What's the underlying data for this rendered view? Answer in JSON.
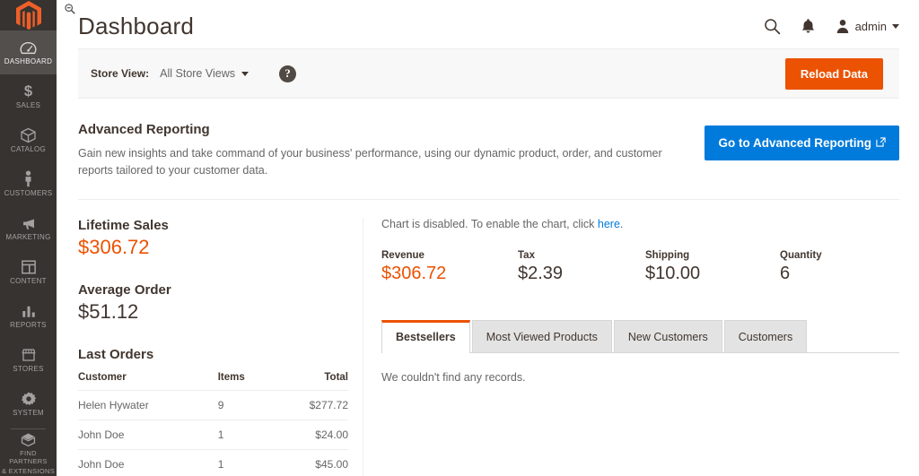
{
  "sidebar": {
    "logo": "magento-logo",
    "items": [
      {
        "label": "DASHBOARD",
        "icon": "gauge-icon",
        "active": true
      },
      {
        "label": "SALES",
        "icon": "dollar-icon",
        "active": false
      },
      {
        "label": "CATALOG",
        "icon": "box-icon",
        "active": false
      },
      {
        "label": "CUSTOMERS",
        "icon": "person-icon",
        "active": false
      },
      {
        "label": "MARKETING",
        "icon": "megaphone-icon",
        "active": false
      },
      {
        "label": "CONTENT",
        "icon": "layout-icon",
        "active": false
      },
      {
        "label": "REPORTS",
        "icon": "bar-chart-icon",
        "active": false
      },
      {
        "label": "STORES",
        "icon": "storefront-icon",
        "active": false
      },
      {
        "label": "SYSTEM",
        "icon": "gear-icon",
        "active": false
      }
    ],
    "partners": {
      "line1": "FIND PARTNERS",
      "line2": "& EXTENSIONS",
      "icon": "extension-box-icon"
    }
  },
  "header": {
    "title": "Dashboard",
    "search_icon": "search-icon",
    "notifications_icon": "bell-icon",
    "account_icon": "user-icon",
    "account_name": "admin"
  },
  "store_switcher": {
    "label": "Store View:",
    "value": "All Store Views",
    "help_icon": "question-mark-icon",
    "reload_label": "Reload Data"
  },
  "advanced_reporting": {
    "title": "Advanced Reporting",
    "description": "Gain new insights and take command of your business' performance, using our dynamic product, order, and customer reports tailored to your customer data.",
    "button_label": "Go to Advanced Reporting",
    "button_icon": "external-link-icon"
  },
  "lifetime_sales": {
    "title": "Lifetime Sales",
    "amount": "$306.72"
  },
  "average_order": {
    "title": "Average Order",
    "amount": "$51.12"
  },
  "last_orders": {
    "title": "Last Orders",
    "columns": {
      "customer": "Customer",
      "items": "Items",
      "total": "Total"
    },
    "rows": [
      {
        "customer": "Helen Hywater",
        "items": "9",
        "total": "$277.72"
      },
      {
        "customer": "John Doe",
        "items": "1",
        "total": "$24.00"
      },
      {
        "customer": "John Doe",
        "items": "1",
        "total": "$45.00"
      }
    ]
  },
  "chart": {
    "message_prefix": "Chart is disabled. To enable the chart, click ",
    "link_label": "here",
    "message_suffix": "."
  },
  "totals": [
    {
      "label": "Revenue",
      "value": "$306.72",
      "accent": true
    },
    {
      "label": "Tax",
      "value": "$2.39",
      "accent": false
    },
    {
      "label": "Shipping",
      "value": "$10.00",
      "accent": false
    },
    {
      "label": "Quantity",
      "value": "6",
      "accent": false
    }
  ],
  "tabs": [
    {
      "label": "Bestsellers",
      "active": true
    },
    {
      "label": "Most Viewed Products",
      "active": false
    },
    {
      "label": "New Customers",
      "active": false
    },
    {
      "label": "Customers",
      "active": false
    }
  ],
  "tab_panel": {
    "empty_message": "We couldn't find any records."
  },
  "colors": {
    "accent_orange": "#eb5202",
    "accent_blue": "#007bdb",
    "sidebar_bg": "#373330",
    "sidebar_active_bg": "#524f4c",
    "text_dark": "#41362f"
  }
}
